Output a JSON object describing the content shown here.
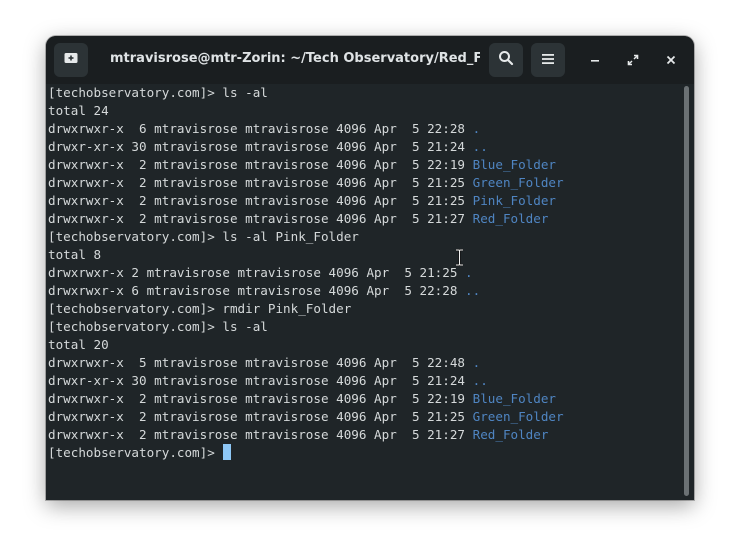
{
  "window": {
    "title": "mtravisrose@mtr-Zorin: ~/Tech Observatory/Red_Fol…"
  },
  "toolbar": {
    "new_tab_icon": "new-tab-icon",
    "search_icon": "search-icon",
    "menu_icon": "hamburger-menu-icon"
  },
  "colors": {
    "background": "#1f2528",
    "titlebar": "#1a1e20",
    "text": "#d5d9da",
    "directory": "#4f85c2",
    "cursor": "#8ec7f5"
  },
  "terminal": {
    "lines": [
      {
        "text": "[techobservatory.com]> ls -al",
        "dir": ""
      },
      {
        "text": "total 24",
        "dir": ""
      },
      {
        "text": "drwxrwxr-x  6 mtravisrose mtravisrose 4096 Apr  5 22:28 ",
        "dir": "."
      },
      {
        "text": "drwxr-xr-x 30 mtravisrose mtravisrose 4096 Apr  5 21:24 ",
        "dir": ".."
      },
      {
        "text": "drwxrwxr-x  2 mtravisrose mtravisrose 4096 Apr  5 22:19 ",
        "dir": "Blue_Folder"
      },
      {
        "text": "drwxrwxr-x  2 mtravisrose mtravisrose 4096 Apr  5 21:25 ",
        "dir": "Green_Folder"
      },
      {
        "text": "drwxrwxr-x  2 mtravisrose mtravisrose 4096 Apr  5 21:25 ",
        "dir": "Pink_Folder"
      },
      {
        "text": "drwxrwxr-x  2 mtravisrose mtravisrose 4096 Apr  5 21:27 ",
        "dir": "Red_Folder"
      },
      {
        "text": "[techobservatory.com]> ls -al Pink_Folder",
        "dir": ""
      },
      {
        "text": "total 8",
        "dir": ""
      },
      {
        "text": "drwxrwxr-x 2 mtravisrose mtravisrose 4096 Apr  5 21:25 ",
        "dir": "."
      },
      {
        "text": "drwxrwxr-x 6 mtravisrose mtravisrose 4096 Apr  5 22:28 ",
        "dir": ".."
      },
      {
        "text": "[techobservatory.com]> rmdir Pink_Folder",
        "dir": ""
      },
      {
        "text": "[techobservatory.com]> ls -al",
        "dir": ""
      },
      {
        "text": "total 20",
        "dir": ""
      },
      {
        "text": "drwxrwxr-x  5 mtravisrose mtravisrose 4096 Apr  5 22:48 ",
        "dir": "."
      },
      {
        "text": "drwxr-xr-x 30 mtravisrose mtravisrose 4096 Apr  5 21:24 ",
        "dir": ".."
      },
      {
        "text": "drwxrwxr-x  2 mtravisrose mtravisrose 4096 Apr  5 22:19 ",
        "dir": "Blue_Folder"
      },
      {
        "text": "drwxrwxr-x  2 mtravisrose mtravisrose 4096 Apr  5 21:25 ",
        "dir": "Green_Folder"
      },
      {
        "text": "drwxrwxr-x  2 mtravisrose mtravisrose 4096 Apr  5 21:27 ",
        "dir": "Red_Folder"
      }
    ],
    "prompt": "[techobservatory.com]> "
  }
}
